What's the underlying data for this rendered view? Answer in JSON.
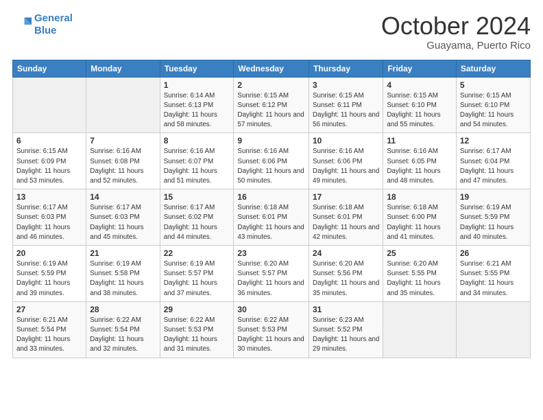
{
  "header": {
    "logo_line1": "General",
    "logo_line2": "Blue",
    "month": "October 2024",
    "location": "Guayama, Puerto Rico"
  },
  "days_of_week": [
    "Sunday",
    "Monday",
    "Tuesday",
    "Wednesday",
    "Thursday",
    "Friday",
    "Saturday"
  ],
  "weeks": [
    [
      {
        "day": "",
        "sunrise": "",
        "sunset": "",
        "daylight": ""
      },
      {
        "day": "",
        "sunrise": "",
        "sunset": "",
        "daylight": ""
      },
      {
        "day": "1",
        "sunrise": "Sunrise: 6:14 AM",
        "sunset": "Sunset: 6:13 PM",
        "daylight": "Daylight: 11 hours and 58 minutes."
      },
      {
        "day": "2",
        "sunrise": "Sunrise: 6:15 AM",
        "sunset": "Sunset: 6:12 PM",
        "daylight": "Daylight: 11 hours and 57 minutes."
      },
      {
        "day": "3",
        "sunrise": "Sunrise: 6:15 AM",
        "sunset": "Sunset: 6:11 PM",
        "daylight": "Daylight: 11 hours and 56 minutes."
      },
      {
        "day": "4",
        "sunrise": "Sunrise: 6:15 AM",
        "sunset": "Sunset: 6:10 PM",
        "daylight": "Daylight: 11 hours and 55 minutes."
      },
      {
        "day": "5",
        "sunrise": "Sunrise: 6:15 AM",
        "sunset": "Sunset: 6:10 PM",
        "daylight": "Daylight: 11 hours and 54 minutes."
      }
    ],
    [
      {
        "day": "6",
        "sunrise": "Sunrise: 6:15 AM",
        "sunset": "Sunset: 6:09 PM",
        "daylight": "Daylight: 11 hours and 53 minutes."
      },
      {
        "day": "7",
        "sunrise": "Sunrise: 6:16 AM",
        "sunset": "Sunset: 6:08 PM",
        "daylight": "Daylight: 11 hours and 52 minutes."
      },
      {
        "day": "8",
        "sunrise": "Sunrise: 6:16 AM",
        "sunset": "Sunset: 6:07 PM",
        "daylight": "Daylight: 11 hours and 51 minutes."
      },
      {
        "day": "9",
        "sunrise": "Sunrise: 6:16 AM",
        "sunset": "Sunset: 6:06 PM",
        "daylight": "Daylight: 11 hours and 50 minutes."
      },
      {
        "day": "10",
        "sunrise": "Sunrise: 6:16 AM",
        "sunset": "Sunset: 6:06 PM",
        "daylight": "Daylight: 11 hours and 49 minutes."
      },
      {
        "day": "11",
        "sunrise": "Sunrise: 6:16 AM",
        "sunset": "Sunset: 6:05 PM",
        "daylight": "Daylight: 11 hours and 48 minutes."
      },
      {
        "day": "12",
        "sunrise": "Sunrise: 6:17 AM",
        "sunset": "Sunset: 6:04 PM",
        "daylight": "Daylight: 11 hours and 47 minutes."
      }
    ],
    [
      {
        "day": "13",
        "sunrise": "Sunrise: 6:17 AM",
        "sunset": "Sunset: 6:03 PM",
        "daylight": "Daylight: 11 hours and 46 minutes."
      },
      {
        "day": "14",
        "sunrise": "Sunrise: 6:17 AM",
        "sunset": "Sunset: 6:03 PM",
        "daylight": "Daylight: 11 hours and 45 minutes."
      },
      {
        "day": "15",
        "sunrise": "Sunrise: 6:17 AM",
        "sunset": "Sunset: 6:02 PM",
        "daylight": "Daylight: 11 hours and 44 minutes."
      },
      {
        "day": "16",
        "sunrise": "Sunrise: 6:18 AM",
        "sunset": "Sunset: 6:01 PM",
        "daylight": "Daylight: 11 hours and 43 minutes."
      },
      {
        "day": "17",
        "sunrise": "Sunrise: 6:18 AM",
        "sunset": "Sunset: 6:01 PM",
        "daylight": "Daylight: 11 hours and 42 minutes."
      },
      {
        "day": "18",
        "sunrise": "Sunrise: 6:18 AM",
        "sunset": "Sunset: 6:00 PM",
        "daylight": "Daylight: 11 hours and 41 minutes."
      },
      {
        "day": "19",
        "sunrise": "Sunrise: 6:19 AM",
        "sunset": "Sunset: 5:59 PM",
        "daylight": "Daylight: 11 hours and 40 minutes."
      }
    ],
    [
      {
        "day": "20",
        "sunrise": "Sunrise: 6:19 AM",
        "sunset": "Sunset: 5:59 PM",
        "daylight": "Daylight: 11 hours and 39 minutes."
      },
      {
        "day": "21",
        "sunrise": "Sunrise: 6:19 AM",
        "sunset": "Sunset: 5:58 PM",
        "daylight": "Daylight: 11 hours and 38 minutes."
      },
      {
        "day": "22",
        "sunrise": "Sunrise: 6:19 AM",
        "sunset": "Sunset: 5:57 PM",
        "daylight": "Daylight: 11 hours and 37 minutes."
      },
      {
        "day": "23",
        "sunrise": "Sunrise: 6:20 AM",
        "sunset": "Sunset: 5:57 PM",
        "daylight": "Daylight: 11 hours and 36 minutes."
      },
      {
        "day": "24",
        "sunrise": "Sunrise: 6:20 AM",
        "sunset": "Sunset: 5:56 PM",
        "daylight": "Daylight: 11 hours and 35 minutes."
      },
      {
        "day": "25",
        "sunrise": "Sunrise: 6:20 AM",
        "sunset": "Sunset: 5:55 PM",
        "daylight": "Daylight: 11 hours and 35 minutes."
      },
      {
        "day": "26",
        "sunrise": "Sunrise: 6:21 AM",
        "sunset": "Sunset: 5:55 PM",
        "daylight": "Daylight: 11 hours and 34 minutes."
      }
    ],
    [
      {
        "day": "27",
        "sunrise": "Sunrise: 6:21 AM",
        "sunset": "Sunset: 5:54 PM",
        "daylight": "Daylight: 11 hours and 33 minutes."
      },
      {
        "day": "28",
        "sunrise": "Sunrise: 6:22 AM",
        "sunset": "Sunset: 5:54 PM",
        "daylight": "Daylight: 11 hours and 32 minutes."
      },
      {
        "day": "29",
        "sunrise": "Sunrise: 6:22 AM",
        "sunset": "Sunset: 5:53 PM",
        "daylight": "Daylight: 11 hours and 31 minutes."
      },
      {
        "day": "30",
        "sunrise": "Sunrise: 6:22 AM",
        "sunset": "Sunset: 5:53 PM",
        "daylight": "Daylight: 11 hours and 30 minutes."
      },
      {
        "day": "31",
        "sunrise": "Sunrise: 6:23 AM",
        "sunset": "Sunset: 5:52 PM",
        "daylight": "Daylight: 11 hours and 29 minutes."
      },
      {
        "day": "",
        "sunrise": "",
        "sunset": "",
        "daylight": ""
      },
      {
        "day": "",
        "sunrise": "",
        "sunset": "",
        "daylight": ""
      }
    ]
  ]
}
